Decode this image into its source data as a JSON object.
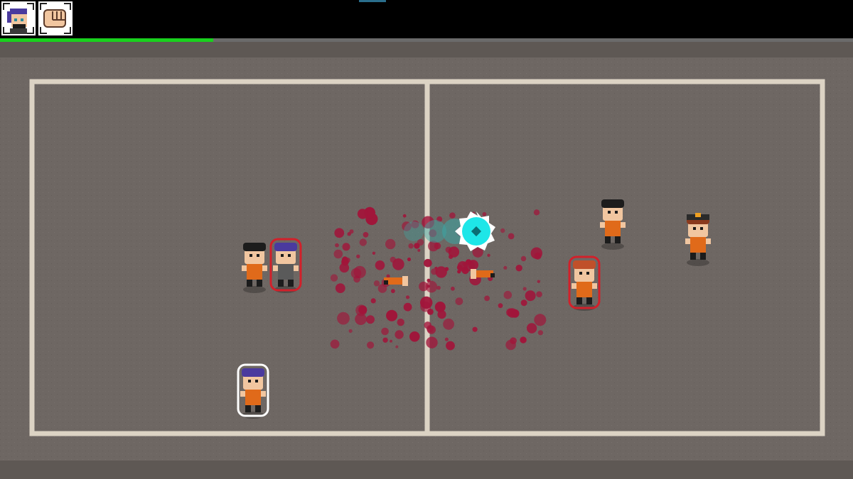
{
  "hud": {
    "portraits": [
      {
        "icon": "player-portrait-icon",
        "hair_color": "#4a3a9e"
      },
      {
        "icon": "fist-weapon-icon"
      }
    ],
    "health": {
      "value": 0.25
    },
    "colors": {
      "health": "#19d11e",
      "health_track": "#6b6b6b"
    }
  },
  "arena": {
    "floor_color": "#6e6763",
    "line_color": "#dcd3c4",
    "characters": [
      {
        "id": "player",
        "role": "player",
        "hair": "#4a3a9e",
        "outfit": "orange-jumpsuit"
      },
      {
        "id": "inmate-black-hair-left",
        "role": "inmate",
        "hair": "#1c1c1c",
        "outfit": "orange-jumpsuit"
      },
      {
        "id": "inmate-purple-hair-hostile",
        "role": "hostile",
        "hair": "#4a3a9e",
        "outfit": "grey-jumpsuit"
      },
      {
        "id": "inmate-black-hair-right",
        "role": "inmate",
        "hair": "#1c1c1c",
        "outfit": "orange-jumpsuit"
      },
      {
        "id": "inmate-cap",
        "role": "inmate",
        "hair": "#8a3a1e",
        "outfit": "orange-jumpsuit"
      },
      {
        "id": "inmate-redhead-hostile",
        "role": "hostile",
        "hair": "#c0502a",
        "outfit": "orange-jumpsuit"
      }
    ],
    "effects": {
      "saw_blade_color": "#1ee6e8",
      "blood_color": "#a1153a"
    }
  }
}
